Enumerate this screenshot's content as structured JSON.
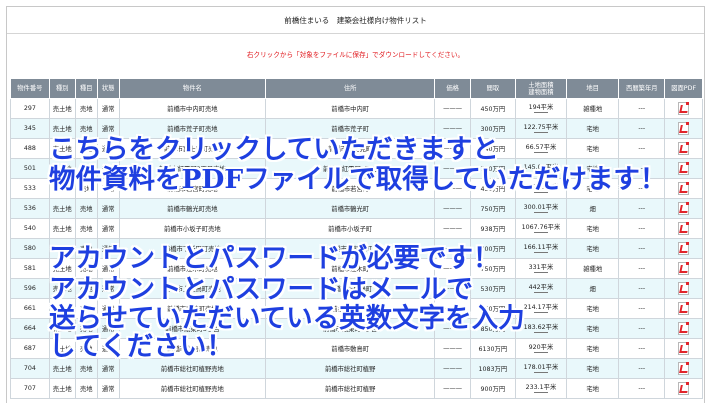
{
  "page": {
    "title": "前橋住まいる　建築会社様向け物件リスト",
    "note": "右クリックから「対象をファイルに保存」でダウンロードしてください。"
  },
  "table": {
    "headers": [
      "物件番号",
      "種別",
      "種目",
      "状態",
      "物件名",
      "住所",
      "価格",
      "間取",
      "土地面積\n建物面積",
      "地目",
      "西暦築年月",
      "図面PDF"
    ],
    "area_unit": "平米",
    "rows": [
      {
        "no": "297",
        "type": "売土地",
        "kind": "売地",
        "status": "通常",
        "name": "前橋市中内町売地",
        "address": "前橋市中内町",
        "price": "———",
        "layout": "450万円",
        "area": "194",
        "chimoku": "雑種地",
        "built": "---"
      },
      {
        "no": "345",
        "type": "売土地",
        "kind": "売地",
        "status": "通常",
        "name": "前橋市荒子町売地",
        "address": "前橋市荒子町",
        "price": "———",
        "layout": "300万円",
        "area": "122.75",
        "chimoku": "宅地",
        "built": "---"
      },
      {
        "no": "488",
        "type": "売土地",
        "kind": "売地",
        "status": "通常",
        "name": "前橋市富士見町売地",
        "address": "前橋市富士見町",
        "price": "———",
        "layout": "840万円",
        "area": "66.57",
        "chimoku": "宅地",
        "built": "---"
      },
      {
        "no": "501",
        "type": "売土地",
        "kind": "売地",
        "status": "通常",
        "name": "前橋市紅雲町3丁目売地",
        "address": "前橋市紅雲町3丁目",
        "price": "———",
        "layout": "710万円",
        "area": "145.07",
        "chimoku": "宅地",
        "built": "---"
      },
      {
        "no": "533",
        "type": "売土地",
        "kind": "売地",
        "status": "通常",
        "name": "前橋市若宮町売地",
        "address": "前橋市若宮町",
        "price": "———",
        "layout": "430万円",
        "area": "165.21",
        "chimoku": "宅地",
        "built": "---"
      },
      {
        "no": "536",
        "type": "売土地",
        "kind": "売地",
        "status": "通常",
        "name": "前橋市鶴光町売地",
        "address": "前橋市鶴光町",
        "price": "———",
        "layout": "750万円",
        "area": "300.01",
        "chimoku": "畑",
        "built": "---"
      },
      {
        "no": "540",
        "type": "売土地",
        "kind": "売地",
        "status": "通常",
        "name": "前橋市小坂子町売地",
        "address": "前橋市小坂子町",
        "price": "———",
        "layout": "938万円",
        "area": "1067.76",
        "chimoku": "宅地",
        "built": "---"
      },
      {
        "no": "580",
        "type": "売土地",
        "kind": "売地",
        "status": "通常",
        "name": "前橋市下新田町売地",
        "address": "前橋市下新田町",
        "price": "———",
        "layout": "700万円",
        "area": "166.11",
        "chimoku": "宅地",
        "built": "---"
      },
      {
        "no": "581",
        "type": "売土地",
        "kind": "売地",
        "status": "通常",
        "name": "前橋市江木町売地",
        "address": "前橋市江木町",
        "price": "———",
        "layout": "750万円",
        "area": "331",
        "chimoku": "雑種地",
        "built": "---"
      },
      {
        "no": "596",
        "type": "売土地",
        "kind": "売地",
        "status": "通常",
        "name": "前橋市上佐鳥町売地",
        "address": "前橋市上佐鳥町",
        "price": "———",
        "layout": "530万円",
        "area": "442",
        "chimoku": "畑",
        "built": "---"
      },
      {
        "no": "661",
        "type": "売土地",
        "kind": "売地",
        "status": "通常",
        "name": "前橋市岩神町売地",
        "address": "前橋市岩神町",
        "price": "———",
        "layout": "850万円",
        "area": "214.17",
        "chimoku": "宅地",
        "built": "---"
      },
      {
        "no": "664",
        "type": "売土地",
        "kind": "売地",
        "status": "通常",
        "name": "前橋市紙東町3丁目",
        "address": "前橋市紙東町3丁目",
        "price": "———",
        "layout": "850万円",
        "area": "183.62",
        "chimoku": "宅地",
        "built": "---"
      },
      {
        "no": "687",
        "type": "売土地",
        "kind": "売地",
        "status": "通常",
        "name": "前橋市敷島町売地",
        "address": "前橋市敷島町",
        "price": "———",
        "layout": "6130万円",
        "area": "920",
        "chimoku": "宅地",
        "built": "---"
      },
      {
        "no": "704",
        "type": "売土地",
        "kind": "売地",
        "status": "通常",
        "name": "前橋市総社町植野売地",
        "address": "前橋市総社町植野",
        "price": "———",
        "layout": "1083万円",
        "area": "178.01",
        "chimoku": "宅地",
        "built": "---"
      },
      {
        "no": "707",
        "type": "売土地",
        "kind": "売地",
        "status": "通常",
        "name": "前橋市総社町植野売地",
        "address": "前橋市総社町植野",
        "price": "———",
        "layout": "900万円",
        "area": "233.1",
        "chimoku": "宅地",
        "built": "---"
      }
    ]
  },
  "overlay": {
    "line1": "こちらをクリックしていただきますと",
    "line2": "物件資料をPDFファイルで取得していただけます！",
    "line3": "アカウントとパスワードが必要です！",
    "line4": "アカウントとパスワードはメールで",
    "line5": "送らせていただいている英数文字を入力",
    "line6": "してください！"
  },
  "colors": {
    "header_bg": "#7f8b97",
    "row_alt_bg": "#e9f8fb",
    "note_red": "#e0191e",
    "overlay_blue": "#1e3fe0",
    "pdf_red": "#e1252b"
  },
  "icons": {
    "pdf": "pdf-file-icon"
  }
}
